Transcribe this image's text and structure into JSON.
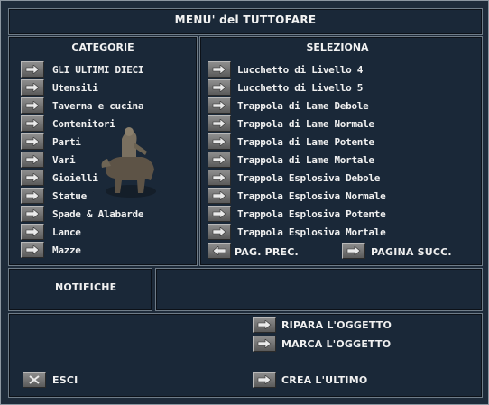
{
  "window": {
    "title": "MENU' del TUTTOFARE"
  },
  "categories": {
    "header": "CATEGORIE",
    "items": [
      {
        "label": "GLI ULTIMI DIECI"
      },
      {
        "label": "Utensili"
      },
      {
        "label": "Taverna e cucina"
      },
      {
        "label": "Contenitori"
      },
      {
        "label": "Parti"
      },
      {
        "label": "Vari"
      },
      {
        "label": "Gioielli"
      },
      {
        "label": "Statue"
      },
      {
        "label": "Spade & Alabarde"
      },
      {
        "label": "Lance"
      },
      {
        "label": "Mazze"
      }
    ]
  },
  "selection": {
    "header": "SELEZIONA",
    "items": [
      {
        "label": "Lucchetto di Livello 4"
      },
      {
        "label": "Lucchetto di Livello 5"
      },
      {
        "label": "Trappola di Lame Debole"
      },
      {
        "label": "Trappola di Lame Normale"
      },
      {
        "label": "Trappola di Lame Potente"
      },
      {
        "label": "Trappola di Lame Mortale"
      },
      {
        "label": "Trappola Esplosiva Debole"
      },
      {
        "label": "Trappola Esplosiva Normale"
      },
      {
        "label": "Trappola Esplosiva Potente"
      },
      {
        "label": "Trappola Esplosiva Mortale"
      }
    ],
    "prev_label": "PAG. PREC.",
    "next_label": "PAGINA SUCC."
  },
  "notifications": {
    "label": "NOTIFICHE",
    "text": ""
  },
  "actions": {
    "repair_label": "RIPARA L'OGGETTO",
    "mark_label": "MARCA L'OGGETTO",
    "exit_label": "ESCI",
    "make_last_label": "CREA L'ULTIMO"
  },
  "colors": {
    "background": "#1e2b3a",
    "panel": "#1a2838",
    "border": "#6f7c88",
    "button": "#7a7a7a",
    "text": "#eeeeee"
  },
  "icons": {
    "item_button": "arrow-right-icon",
    "exit_button": "x-icon"
  }
}
